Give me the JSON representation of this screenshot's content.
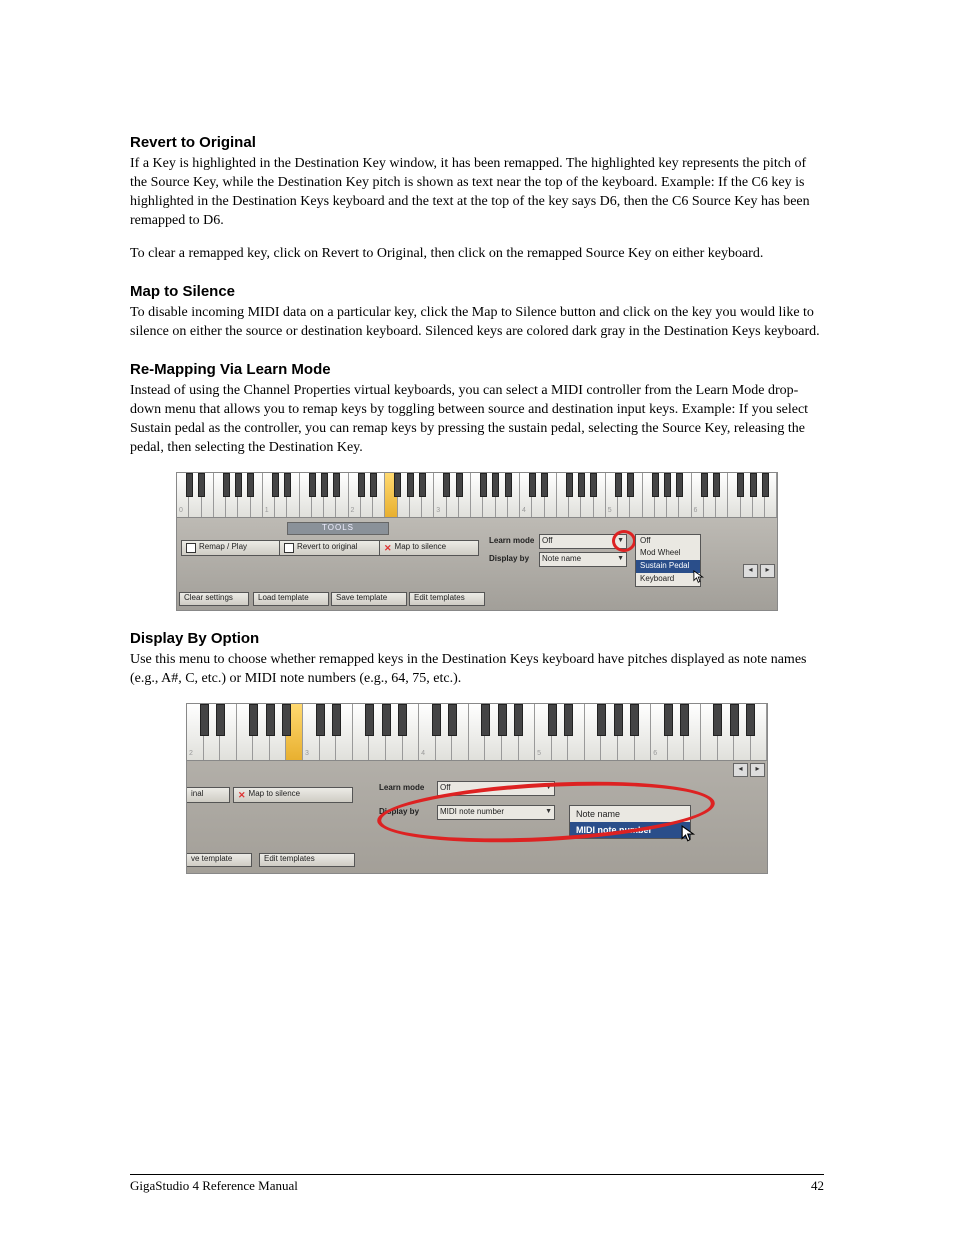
{
  "sections": {
    "revert": {
      "title": "Revert to Original",
      "p1": "If a Key is highlighted in the Destination Key window, it has been remapped. The highlighted key represents the pitch of the Source Key, while the Destination Key pitch is shown as text near the top of the keyboard. Example: If the C6 key is highlighted in the Destination Keys keyboard and the text at the top of the key says D6, then the C6 Source Key has been remapped to D6.",
      "p2": "To clear a remapped key, click on Revert to Original, then click on the remapped Source Key on either keyboard."
    },
    "silence": {
      "title": "Map to Silence",
      "p1": "To disable incoming MIDI data on a particular key, click the Map to Silence button and click on the key you would like to silence on either the source or destination keyboard. Silenced keys are colored dark gray in the Destination Keys keyboard."
    },
    "learn": {
      "title": "Re-Mapping Via Learn Mode",
      "p1": "Instead of using the Channel Properties virtual keyboards, you can select a MIDI controller from the Learn Mode drop-down menu that allows you to remap keys by toggling between source and destination input keys. Example: If you select Sustain pedal as the controller, you can remap keys by pressing the sustain pedal, selecting the Source Key, releasing the pedal, then selecting the Destination Key."
    },
    "display": {
      "title": "Display By Option",
      "p1": "Use this menu to choose whether remapped keys in the Destination Keys keyboard have pitches displayed as note names (e.g., A#, C, etc.) or MIDI note numbers (e.g., 64, 75, etc.)."
    }
  },
  "fig1": {
    "octaves": [
      "0",
      "1",
      "2",
      "3",
      "4",
      "5",
      "6"
    ],
    "tools_header": "TOOLS",
    "buttons": {
      "remap": "Remap / Play",
      "revert": "Revert to original",
      "silence": "Map to silence",
      "clear": "Clear settings",
      "load": "Load template",
      "save": "Save template",
      "edit": "Edit templates"
    },
    "labels": {
      "learn": "Learn mode",
      "display": "Display by"
    },
    "combos": {
      "learn_value": "Off",
      "display_value": "Note name"
    },
    "menu": [
      "Off",
      "Mod Wheel",
      "Sustain Pedal",
      "Keyboard"
    ]
  },
  "fig2": {
    "octaves": [
      "2",
      "3",
      "4",
      "5",
      "6"
    ],
    "buttons": {
      "inal": "inal",
      "silence": "Map to silence",
      "save": "ve template",
      "edit": "Edit templates"
    },
    "labels": {
      "learn": "Learn mode",
      "display": "Display by"
    },
    "combos": {
      "learn_value": "Off",
      "display_value": "MIDI note number"
    },
    "menu": [
      "Note name",
      "MIDI note number"
    ]
  },
  "footer": {
    "left": "GigaStudio 4 Reference Manual",
    "page": "42"
  }
}
